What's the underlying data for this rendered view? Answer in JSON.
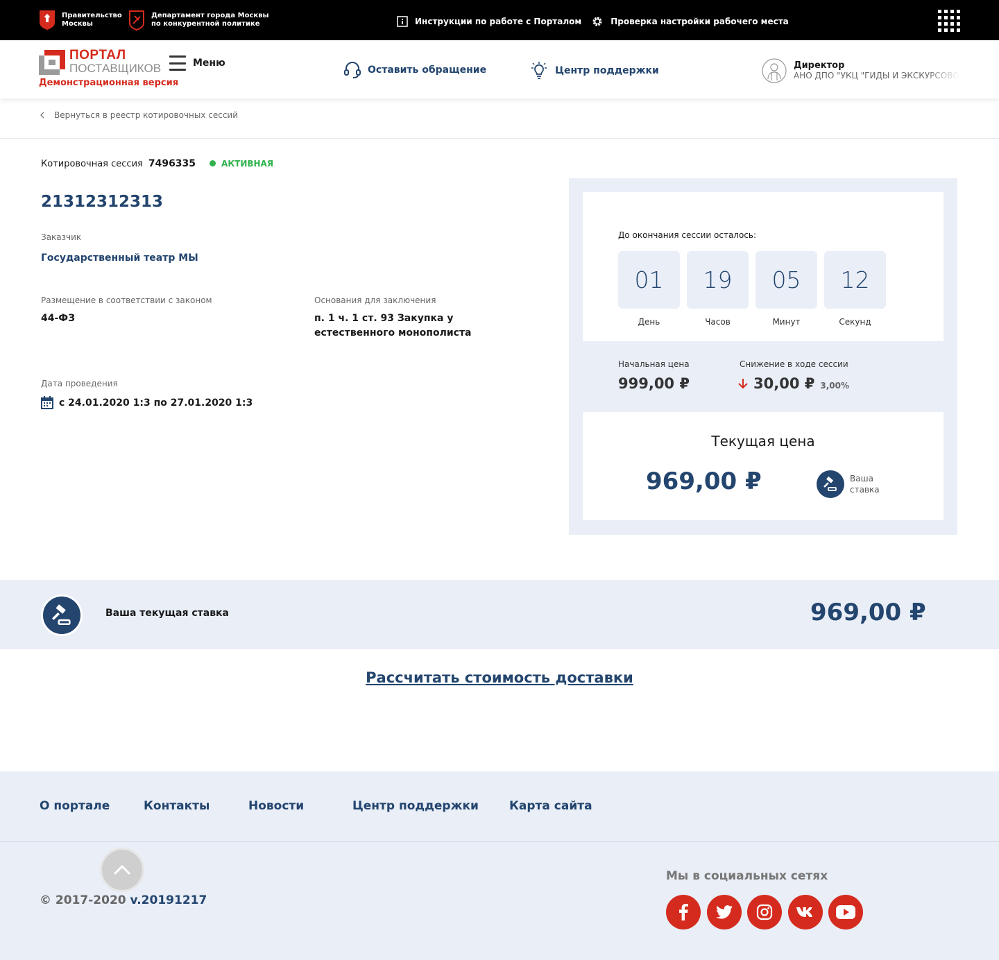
{
  "topbar": {
    "gov1": "Правительство\nМосквы",
    "gov2": "Департамент города Москвы\nпо конкурентной политике",
    "instructions": "Инструкции по работе с Порталом",
    "check": "Проверка настройки рабочего места"
  },
  "header": {
    "logo_line1": "ПОРТАЛ",
    "logo_line2": "ПОСТАВЩИКОВ",
    "demo": "Демонстрационная версия",
    "menu": "Меню",
    "appeal": "Оставить обращение",
    "support": "Центр поддержки",
    "user_role": "Директор",
    "user_org": "АНО ДПО \"УКЦ \"ГИДЫ И ЭКСКУРСОВОДЫ\""
  },
  "breadcrumb": "Вернуться в реестр котировочных сессий",
  "session": {
    "label": "Котировочная сессия",
    "number": "7496335",
    "status": "АКТИВНАЯ",
    "status_color": "#2fb24b",
    "title": "21312312313",
    "customer_label": "Заказчик",
    "customer": "Государственный театр МЫ",
    "law_label": "Размещение в соответствии с законом",
    "law": "44-ФЗ",
    "basis_label": "Основания для заключения",
    "basis": "п. 1 ч. 1 ст. 93 Закупка у естественного монополиста",
    "date_label": "Дата проведения",
    "date": "с 24.01.2020 1:3 по 27.01.2020 1:3"
  },
  "timer": {
    "label": "До окончания сессии осталось:",
    "units": [
      {
        "value": "01",
        "caption": "День"
      },
      {
        "value": "19",
        "caption": "Часов"
      },
      {
        "value": "05",
        "caption": "Минут"
      },
      {
        "value": "12",
        "caption": "Секунд"
      }
    ]
  },
  "prices": {
    "start_label": "Начальная цена",
    "start": "999,00 ₽",
    "drop_label": "Снижение в ходе сессии",
    "drop": "30,00 ₽",
    "drop_pct": "3,00%",
    "current_title": "Текущая цена",
    "current": "969,00 ₽",
    "your_bid": "Ваша\nставка"
  },
  "band": {
    "label": "Ваша текущая ставка",
    "value": "969,00 ₽"
  },
  "calc_link": "Рассчитать стоимость доставки",
  "footer": {
    "nav": [
      "О портале",
      "Контакты",
      "Новости",
      "Центр поддержки",
      "Карта сайта"
    ],
    "copyright": "© 2017-2020",
    "version": "v.20191217",
    "social_title": "Мы в социальных сетях",
    "social": [
      "facebook-icon",
      "twitter-icon",
      "instagram-icon",
      "vk-icon",
      "youtube-icon"
    ]
  },
  "colors": {
    "brand_red": "#d52b1e",
    "brand_blue": "#23456e",
    "panel_bg": "#e9eef7"
  }
}
